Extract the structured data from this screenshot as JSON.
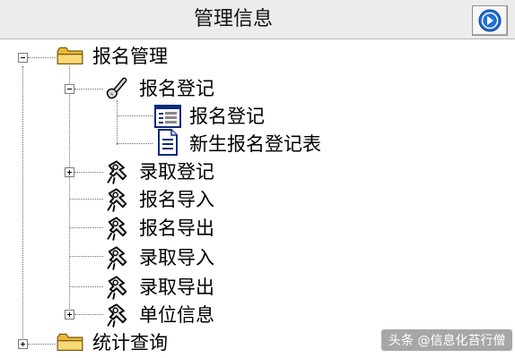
{
  "header": {
    "title": "管理信息",
    "nav_icon": "forward-arrow-icon"
  },
  "tree": {
    "root1": {
      "label": "报名管理",
      "expanded": true,
      "icon": "folder-icon",
      "children": {
        "registration": {
          "label": "报名登记",
          "expanded": true,
          "icon": "scroll-icon",
          "children": [
            {
              "label": "报名登记",
              "icon": "form-icon"
            },
            {
              "label": "新生报名登记表",
              "icon": "document-icon"
            }
          ]
        },
        "admission_registration": {
          "label": "录取登记",
          "expanded": false,
          "icon": "key-icon"
        },
        "registration_import": {
          "label": "报名导入",
          "icon": "key-icon"
        },
        "registration_export": {
          "label": "报名导出",
          "icon": "key-icon"
        },
        "admission_import": {
          "label": "录取导入",
          "icon": "key-icon"
        },
        "admission_export": {
          "label": "录取导出",
          "icon": "key-icon"
        },
        "unit_info": {
          "label": "单位信息",
          "expanded": false,
          "icon": "key-icon"
        }
      }
    },
    "root2": {
      "label": "统计查询",
      "expanded": false,
      "icon": "folder-icon"
    }
  },
  "watermark": "头条 @信息化苔行僧",
  "colors": {
    "header_bg": "#ececec",
    "nav_button_blue": "#1f6fd6",
    "folder_yellow": "#f6d36b"
  }
}
